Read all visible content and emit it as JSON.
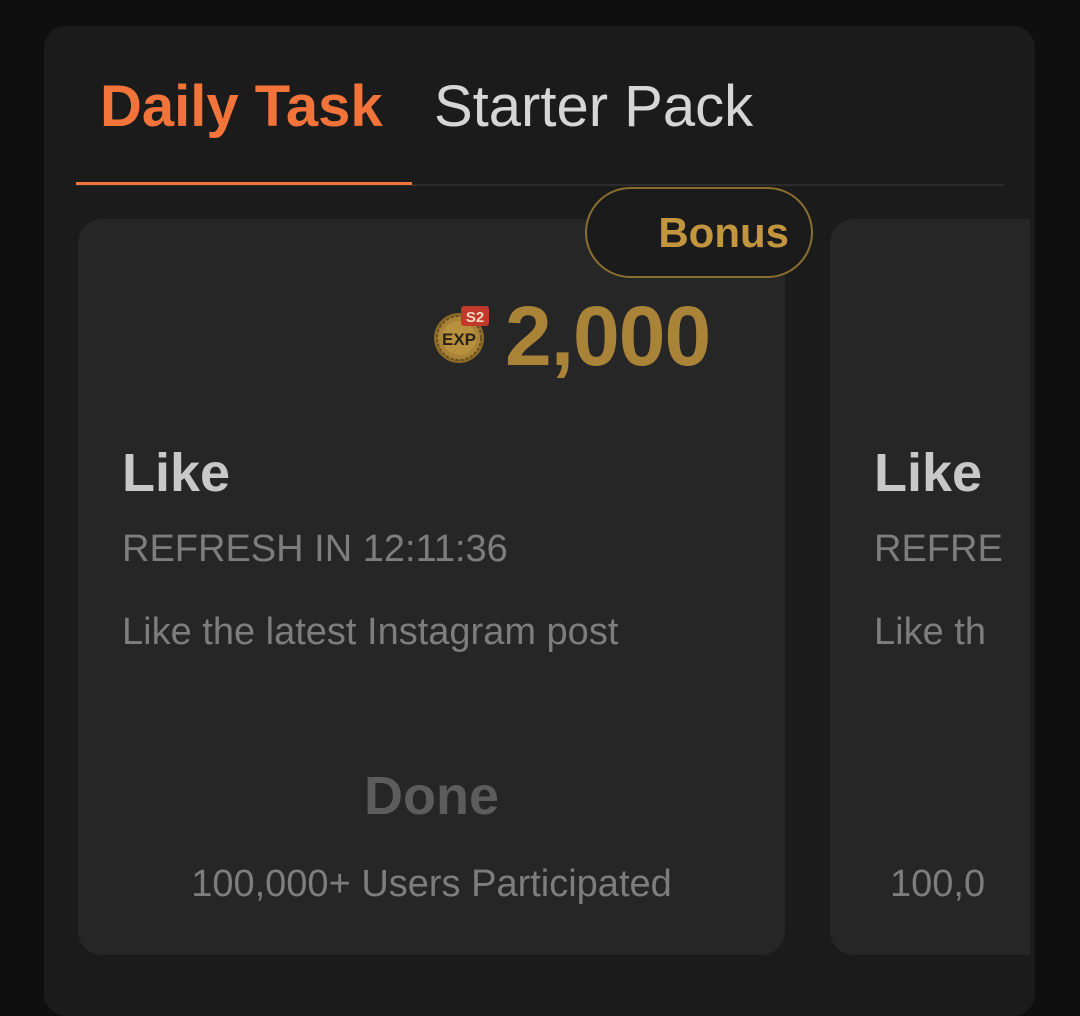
{
  "tabs": [
    {
      "label": "Daily Task",
      "active": true
    },
    {
      "label": "Starter Pack",
      "active": false
    }
  ],
  "colors": {
    "accent": "#f3743b",
    "gold": "#a88338",
    "panel": "#1b1b1b",
    "card": "#262626"
  },
  "cards": [
    {
      "bonus_label": "Bonus",
      "exp_badge": {
        "icon": "exp-coin-icon",
        "season": "S2",
        "text": "EXP"
      },
      "reward": "2,000",
      "title": "Like",
      "refresh": "REFRESH IN 12:11:36",
      "description": "Like the latest Instagram post",
      "status": "Done",
      "participants": "100,000+ Users Participated"
    },
    {
      "title": "Like",
      "refresh": "REFRE",
      "description": "Like th",
      "participants": "100,0"
    }
  ]
}
